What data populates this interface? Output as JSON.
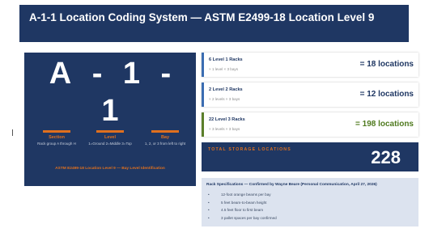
{
  "slide": {
    "title": "A-1-1 Location Coding System — ASTM E2499-18 Location Level 9"
  },
  "code_panel": {
    "segment_a": "A",
    "dash1": "-",
    "segment_b": "1",
    "dash2": "-",
    "segment_c": "1",
    "segments": [
      {
        "name": "Section",
        "desc": "Rack group A through H"
      },
      {
        "name": "Level",
        "desc": "1=Ground 2=Middle 3=Top"
      },
      {
        "name": "Bay",
        "desc": "1, 2, or 3 from left to right"
      }
    ],
    "caption": "ASTM E2499-18 Location Level 9 — Bay Level Identification"
  },
  "racks": [
    {
      "label": "6 Level 1 Racks",
      "sub": "× 1 level × 3 bays",
      "count": "= 18 locations",
      "accent": "#3b6db2"
    },
    {
      "label": "2 Level 2 Racks",
      "sub": "× 2 levels × 3 bays",
      "count": "= 12 locations",
      "accent": "#3b6db2"
    },
    {
      "label": "22 Level 3 Racks",
      "sub": "× 3 levels × 3 bays",
      "count": "= 198 locations",
      "accent": "#5b7f2a"
    }
  ],
  "total": {
    "label": "TOTAL STORAGE LOCATIONS",
    "value": "228"
  },
  "specs": {
    "heading": "Rack Specifications — Confirmed by Wayne Beare (Personal Communication, April 27, 2026)",
    "bullet": "•",
    "items": [
      "12-foot orange beams per bay",
      "5 feet beam-to-beam height",
      "4.5 feet floor to first beam",
      "3 pallet spaces per bay confirmed"
    ]
  },
  "colors": {
    "navy": "#1f3763",
    "orange": "#e0701e",
    "blue_accent": "#3b6db2",
    "green_accent": "#5b7f2a",
    "spec_bg": "#dce3ef"
  }
}
